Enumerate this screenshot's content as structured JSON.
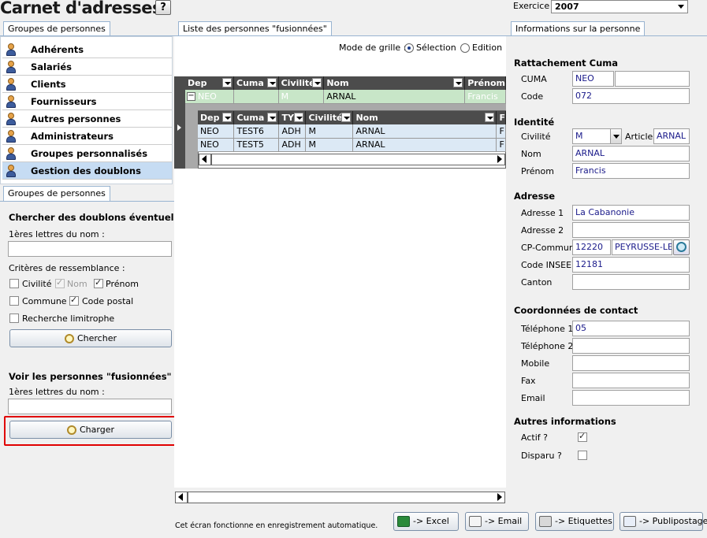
{
  "header": {
    "title": "Carnet d'adresses",
    "help": "?",
    "exercice_label": "Exercice",
    "exercice_value": "2007"
  },
  "tabs": {
    "left_top": "Groupes de personnes",
    "center": "Liste des personnes \"fusionnées\"",
    "right": "Informations sur la personne",
    "left_bottom": "Groupes de personnes"
  },
  "nav": {
    "items": [
      {
        "label": "Adhérents"
      },
      {
        "label": "Salariés"
      },
      {
        "label": "Clients"
      },
      {
        "label": "Fournisseurs"
      },
      {
        "label": "Autres personnes"
      },
      {
        "label": "Administrateurs"
      },
      {
        "label": "Groupes personnalisés"
      },
      {
        "label": "Gestion des doublons"
      }
    ]
  },
  "search": {
    "title": "Chercher des doublons éventuels",
    "first_letters_label": "1ères lettres du nom :",
    "first_letters_value": "",
    "criteria_label": "Critères de ressemblance :",
    "civilite": "Civilité",
    "nom": "Nom",
    "prenom": "Prénom",
    "commune": "Commune",
    "code_postal": "Code postal",
    "limitrophe": "Recherche limitrophe",
    "button": "Chercher"
  },
  "merged": {
    "title": "Voir les personnes \"fusionnées\"",
    "first_letters_label": "1ères lettres du nom :",
    "first_letters_value": "",
    "button": "Charger"
  },
  "grid_mode": {
    "label": "Mode de grille :",
    "selection": "Sélection",
    "edition": "Edition"
  },
  "grid": {
    "headers": [
      "Dep",
      "Cuma",
      "Civilité",
      "Nom",
      "Prénom"
    ],
    "row": {
      "expander": "−",
      "dep": "NEO",
      "cuma": "",
      "civilite": "M",
      "nom": "ARNAL",
      "prenom": "Francis"
    },
    "sub_headers": [
      "Dep",
      "Cuma",
      "TY",
      "Civilité",
      "Nom",
      "F"
    ],
    "sub_rows": [
      {
        "dep": "NEO",
        "cuma": "TEST6",
        "ty": "ADH",
        "civilite": "M",
        "nom": "ARNAL",
        "f": "F"
      },
      {
        "dep": "NEO",
        "cuma": "TEST5",
        "ty": "ADH",
        "civilite": "M",
        "nom": "ARNAL",
        "f": "F"
      }
    ]
  },
  "footer_note": "Cet écran fonctionne en enregistrement automatique.",
  "info": {
    "rattachement": "Rattachement Cuma",
    "cuma_label": "CUMA",
    "cuma_value": "NEO",
    "cuma_value2": "",
    "code_label": "Code",
    "code_value": "072",
    "identite": "Identité",
    "civilite_label": "Civilité",
    "civilite_value": "M",
    "article_label": "Article",
    "article_value": "ARNAL",
    "nom_label": "Nom",
    "nom_value": "ARNAL",
    "prenom_label": "Prénom",
    "prenom_value": "Francis",
    "adresse": "Adresse",
    "adresse1_label": "Adresse 1",
    "adresse1_value": "La Cabanonie",
    "adresse2_label": "Adresse 2",
    "adresse2_value": "",
    "cp_label": "CP-Commune",
    "cp_value": "12220",
    "commune_value": "PEYRUSSE-LE-F",
    "insee_label": "Code INSEE",
    "insee_value": "12181",
    "canton_label": "Canton",
    "canton_value": "",
    "contact": "Coordonnées de contact",
    "tel1_label": "Téléphone 1",
    "tel1_value": "05",
    "tel2_label": "Téléphone 2",
    "tel2_value": "",
    "mobile_label": "Mobile",
    "mobile_value": "",
    "fax_label": "Fax",
    "fax_value": "",
    "email_label": "Email",
    "email_value": "",
    "autres": "Autres informations",
    "actif_label": "Actif ?",
    "disparu_label": "Disparu ?"
  },
  "buttons": {
    "excel": "-> Excel",
    "email": "-> Email",
    "etiquettes": "-> Etiquettes",
    "publipostage": "-> Publipostage"
  }
}
